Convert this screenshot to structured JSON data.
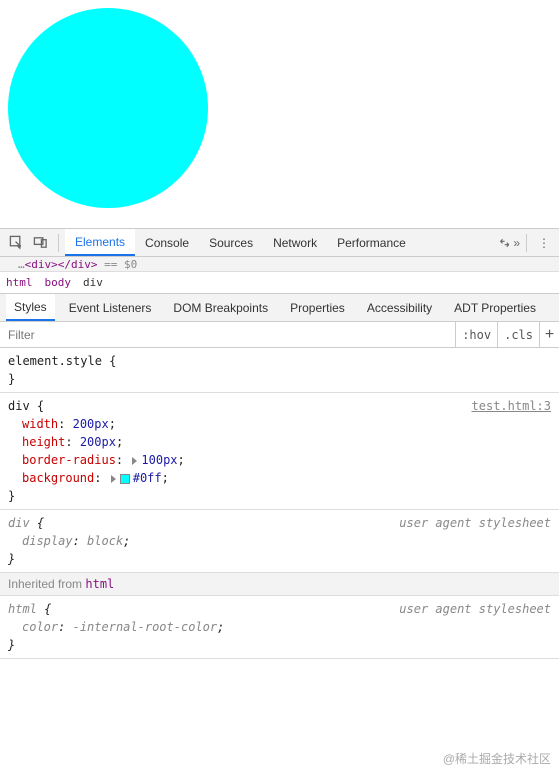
{
  "circle": {
    "color": "#0ff"
  },
  "toolbar": {
    "tabs": [
      "Elements",
      "Console",
      "Sources",
      "Network",
      "Performance"
    ],
    "active": 0
  },
  "dom_preview": "<div></div> == $0",
  "breadcrumb": [
    "html",
    "body",
    "div"
  ],
  "breadcrumb_selected": 2,
  "sub_tabs": [
    "Styles",
    "Event Listeners",
    "DOM Breakpoints",
    "Properties",
    "Accessibility",
    "ADT Properties"
  ],
  "sub_active": 0,
  "filter": {
    "placeholder": "Filter",
    "hov": ":hov",
    "cls": ".cls"
  },
  "rules": [
    {
      "selector": "element.style",
      "source": null,
      "ua": false,
      "decls": []
    },
    {
      "selector": "div",
      "source": "test.html:3",
      "source_link": true,
      "ua": false,
      "decls": [
        {
          "prop": "width",
          "val": "200px",
          "expand": false,
          "swatch": null
        },
        {
          "prop": "height",
          "val": "200px",
          "expand": false,
          "swatch": null
        },
        {
          "prop": "border-radius",
          "val": "100px",
          "expand": true,
          "swatch": null
        },
        {
          "prop": "background",
          "val": "#0ff",
          "expand": true,
          "swatch": "#0ff"
        }
      ]
    },
    {
      "selector": "div",
      "source": "user agent stylesheet",
      "source_link": false,
      "ua": true,
      "decls": [
        {
          "prop": "display",
          "val": "block",
          "expand": false,
          "swatch": null
        }
      ]
    }
  ],
  "inherited_label": "Inherited from",
  "inherited_from": "html",
  "inherited_rules": [
    {
      "selector": "html",
      "source": "user agent stylesheet",
      "source_link": false,
      "ua": true,
      "decls": [
        {
          "prop": "color",
          "val": "-internal-root-color",
          "expand": false,
          "swatch": null
        }
      ]
    }
  ],
  "watermark": "@稀土掘金技术社区"
}
